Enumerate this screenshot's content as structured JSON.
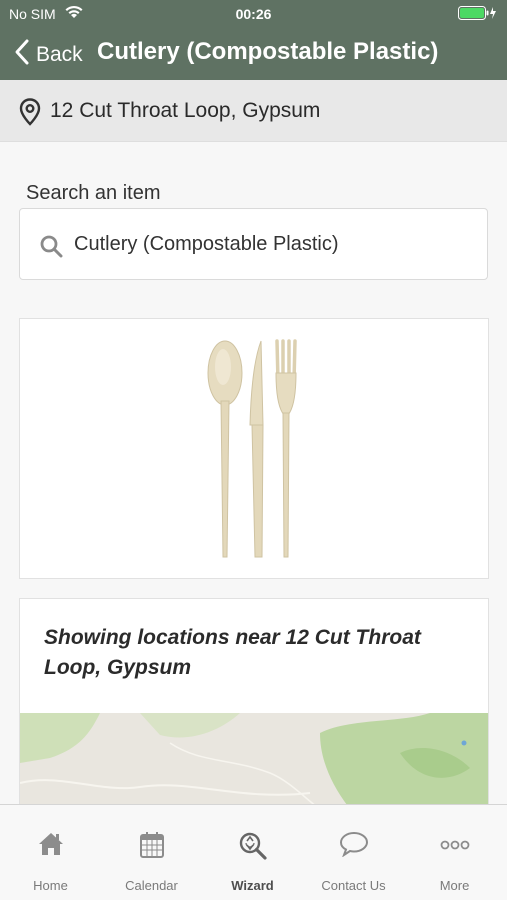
{
  "status_bar": {
    "carrier": "No SIM",
    "time": "00:26"
  },
  "nav": {
    "back_label": "Back",
    "title": "Cutlery (Compostable Plastic)"
  },
  "location": {
    "address": "12 Cut Throat Loop, Gypsum"
  },
  "search": {
    "label": "Search an item",
    "value": "Cutlery (Compostable Plastic)"
  },
  "results": {
    "heading": "Showing locations near 12 Cut Throat Loop, Gypsum"
  },
  "tabs": [
    {
      "label": "Home",
      "icon": "home-icon"
    },
    {
      "label": "Calendar",
      "icon": "calendar-icon"
    },
    {
      "label": "Wizard",
      "icon": "wizard-icon"
    },
    {
      "label": "Contact Us",
      "icon": "speech-bubble-icon"
    },
    {
      "label": "More",
      "icon": "more-icon"
    }
  ],
  "colors": {
    "header": "#5f7263",
    "battery": "#4cd964"
  }
}
